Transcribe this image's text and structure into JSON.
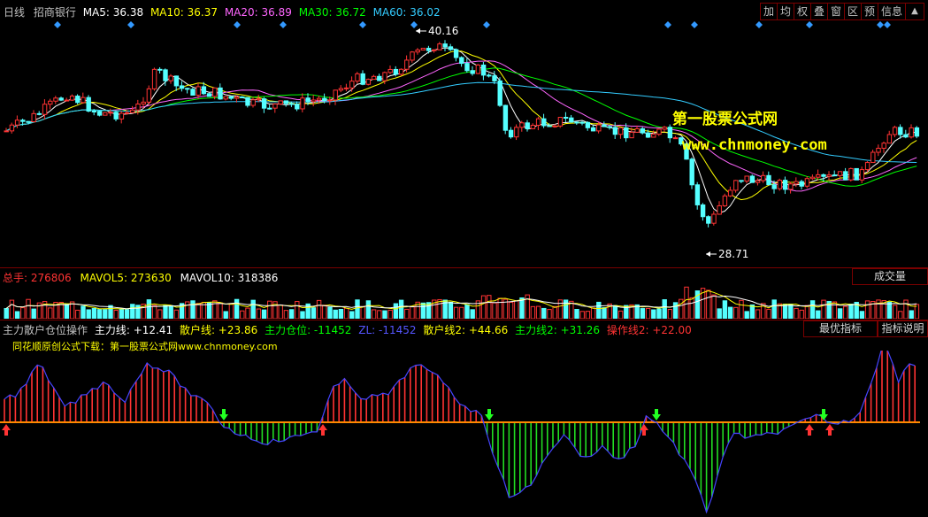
{
  "header": {
    "period": "日线",
    "stock": "招商银行",
    "ma": [
      {
        "label": "MA5: 36.38",
        "color": "#ffffff"
      },
      {
        "label": "MA10: 36.37",
        "color": "#ffff00"
      },
      {
        "label": "MA20: 36.89",
        "color": "#ff66ff"
      },
      {
        "label": "MA30: 36.72",
        "color": "#00ff00"
      },
      {
        "label": "MA60: 36.02",
        "color": "#33ccff"
      }
    ]
  },
  "toolbar": {
    "buttons": [
      "加",
      "均",
      "权",
      "叠",
      "窗",
      "区",
      "预",
      "信息",
      "▲"
    ]
  },
  "price_chart": {
    "high_label": "40.16",
    "low_label": "28.71"
  },
  "watermark": {
    "line1": "第一股票公式网",
    "line2": "www.chnmoney.com"
  },
  "volume": {
    "total_label": "总手: 276806",
    "mavol5": "MAVOL5: 273630",
    "mavol10": "MAVOL10: 318386",
    "button": "成交量"
  },
  "indicator": {
    "name": "主力散户仓位操作",
    "values": [
      {
        "label": "主力线: +12.41",
        "color": "#ffffff"
      },
      {
        "label": "散户线: +23.86",
        "color": "#ffff00"
      },
      {
        "label": "主力仓位: -11452",
        "color": "#00ff00"
      },
      {
        "label": "ZL: -11452",
        "color": "#5555ff"
      },
      {
        "label": "散户线2: +44.66",
        "color": "#ffff00"
      },
      {
        "label": "主力线2: +31.26",
        "color": "#00ff00"
      },
      {
        "label": "操作线2: +22.00",
        "color": "#ff3333"
      }
    ],
    "subtitle": "同花顺原创公式下载：第一股票公式网www.chnmoney.com",
    "btn_opt": "最优指标",
    "btn_desc": "指标说明"
  },
  "colors": {
    "up": "#ff3333",
    "down": "#55ffff",
    "bg": "#000000",
    "border": "#7a0000",
    "osc_pos": "#ff3333",
    "osc_neg": "#22dd22",
    "osc_line": "#4444ff",
    "zero_line": "#ff8800",
    "diamond": "#3399ff",
    "watermark": "#ffff00"
  }
}
